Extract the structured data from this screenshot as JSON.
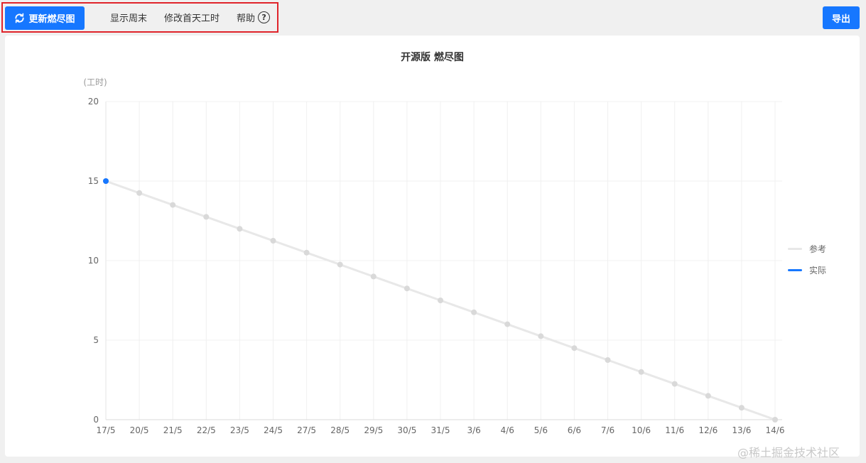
{
  "toolbar": {
    "update_label": "更新燃尽图",
    "show_weekend": "显示周末",
    "edit_first_day": "修改首天工时",
    "help": "帮助",
    "help_glyph": "?",
    "export_label": "导出"
  },
  "colors": {
    "primary": "#1677ff",
    "reference": "#e8e8e8",
    "reference_point": "#d9d9d9",
    "actual": "#1677ff",
    "highlight": "#e0242b"
  },
  "chart_data": {
    "type": "line",
    "title": "开源版 燃尽图",
    "ylabel": "(工时)",
    "xlabel": "",
    "ylim": [
      0,
      20
    ],
    "yticks": [
      0,
      5,
      10,
      15,
      20
    ],
    "grid": true,
    "legend_position": "right",
    "categories": [
      "17/5",
      "20/5",
      "21/5",
      "22/5",
      "23/5",
      "24/5",
      "27/5",
      "28/5",
      "29/5",
      "30/5",
      "31/5",
      "3/6",
      "4/6",
      "5/6",
      "6/6",
      "7/6",
      "10/6",
      "11/6",
      "12/6",
      "13/6",
      "14/6"
    ],
    "series": [
      {
        "name": "参考",
        "values": [
          15,
          14.25,
          13.5,
          12.75,
          12,
          11.25,
          10.5,
          9.75,
          9,
          8.25,
          7.5,
          6.75,
          6,
          5.25,
          4.5,
          3.75,
          3,
          2.25,
          1.5,
          0.75,
          0
        ]
      },
      {
        "name": "实际",
        "values": [
          15
        ]
      }
    ]
  },
  "watermark": "@稀土掘金技术社区"
}
